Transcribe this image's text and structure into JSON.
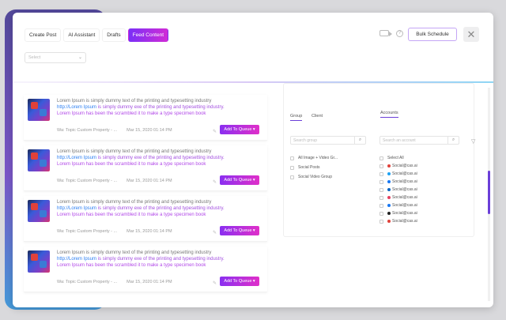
{
  "header": {
    "tabs": [
      {
        "label": "Create Post"
      },
      {
        "label": "AI Assistant"
      },
      {
        "label": "Drafts"
      },
      {
        "label": "Feed Content"
      }
    ],
    "select_value": "Select",
    "info_glyph": "?",
    "bulk_label": "Bulk Schedule",
    "close_glyph": "✕"
  },
  "feed": {
    "items": [
      {
        "line1": "Lorem Ipsum is simply dummy text of the printing and typesetting industry",
        "link": "http://Lorem Ipsum",
        "line2_rest": " is simply dummy exe of the printing and typesetting industry.",
        "line3": "Lorem Ipsum has been the scrambled it to make a type specimen book",
        "source": "Wa: Topic Custom Property - ...",
        "date": "Mar 15, 2020 01:14 PM",
        "queue_label": "Add To Queue ▾"
      },
      {
        "line1": "Lorem Ipsum is simply dummy text of the printing and typesetting industry",
        "link": "http://Lorem Ipsum",
        "line2_rest": " is simply dummy exe of the printing and typesetting industry.",
        "line3": "Lorem Ipsum has been the scrambled it to make a type specimen book",
        "source": "Wa: Topic Custom Property - ...",
        "date": "Mar 15, 2020 01:14 PM",
        "queue_label": "Add To Queue ▾"
      },
      {
        "line1": "Lorem Ipsum is simply dummy text of the printing and typesetting industry",
        "link": "http://Lorem Ipsum",
        "line2_rest": " is simply dummy exe of the printing and typesetting industry.",
        "line3": "Lorem Ipsum has been the scrambled it to make a type specimen book",
        "source": "Wa: Topic Custom Property - ...",
        "date": "Mar 15, 2020 01:14 PM",
        "queue_label": "Add To Queue ▾"
      },
      {
        "line1": "Lorem Ipsum is simply dummy text of the printing and typesetting industry",
        "link": "http://Lorem Ipsum",
        "line2_rest": " is simply dummy exe of the printing and typesetting industry.",
        "line3": "Lorem Ipsum has been the scrambled it to make a type specimen book",
        "source": "Wa: Topic Custom Property - ...",
        "date": "Mar 15, 2020 01:14 PM",
        "queue_label": "Add To Queue ▾"
      }
    ]
  },
  "panel": {
    "tab_group": "Group",
    "tab_client": "Client",
    "tab_accounts": "Accounts",
    "group_search_placeholder": "Search group",
    "account_search_placeholder": "Search an account",
    "groups": [
      {
        "label": "All Image + Video Gr..."
      },
      {
        "label": "Social Posts"
      },
      {
        "label": "Social Video Group"
      }
    ],
    "select_all": "Select All",
    "accounts": [
      {
        "label": "Social@cas.ai",
        "color": "#e0413a"
      },
      {
        "label": "Social@cas.ai",
        "color": "#1da1f2"
      },
      {
        "label": "Social@cas.ai",
        "color": "#1877f2"
      },
      {
        "label": "Social@cas.ai",
        "color": "#0a66c2"
      },
      {
        "label": "Social@cas.ai",
        "color": "#e4405f"
      },
      {
        "label": "Social@cas.ai",
        "color": "#1877f2"
      },
      {
        "label": "Social@cas.ai",
        "color": "#222222"
      },
      {
        "label": "Social@cas.ai",
        "color": "#e0413a"
      }
    ]
  },
  "colors": {
    "accent_start": "#7b2ff7",
    "accent_end": "#d02cd6"
  }
}
